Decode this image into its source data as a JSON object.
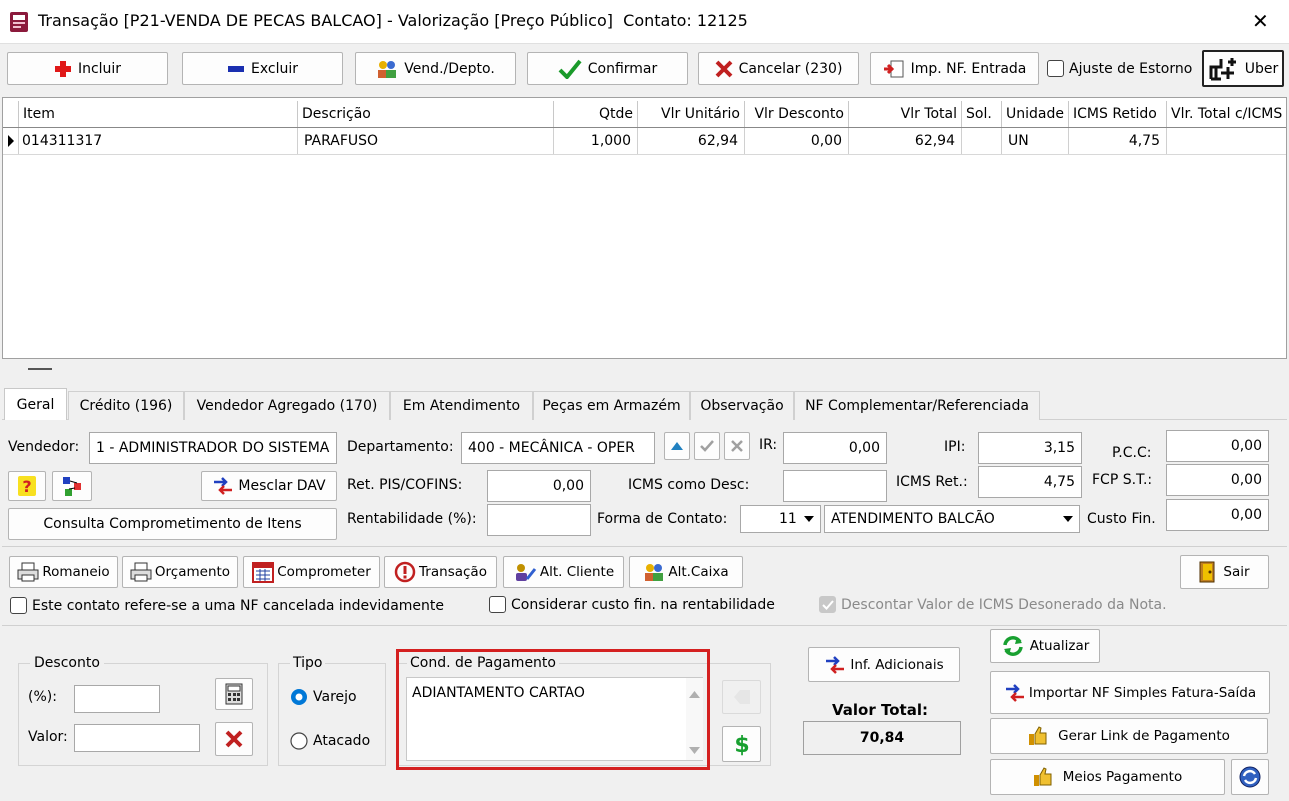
{
  "window": {
    "title": "Transação [P21-VENDA DE PECAS BALCAO] - Valorização [Preço Público]  Contato: 12125",
    "close": "✕"
  },
  "toolbar": {
    "incluir": "Incluir",
    "excluir": "Excluir",
    "vend": "Vend./Depto.",
    "confirmar": "Confirmar",
    "cancelar": "Cancelar (230)",
    "imp_nf": "Imp. NF. Entrada",
    "ajuste": "Ajuste de Estorno",
    "uber": "Uber"
  },
  "grid": {
    "headers": [
      "Item",
      "Descrição",
      "Qtde",
      "Vlr Unitário",
      "Vlr Desconto",
      "Vlr Total",
      "Sol.",
      "Unidade",
      "ICMS Retido",
      "Vlr. Total c/ICMS"
    ],
    "rows": [
      {
        "item": "014311317",
        "descricao": "PARAFUSO",
        "qtde": "1,000",
        "vlr_unit": "62,94",
        "vlr_desc": "0,00",
        "vlr_total": "62,94",
        "sol": "",
        "unidade": "UN",
        "icms_retido": "4,75",
        "total_icms": ""
      }
    ]
  },
  "tabs": [
    "Geral",
    "Crédito (196)",
    "Vendedor Agregado (170)",
    "Em Atendimento",
    "Peças em Armazém",
    "Observação",
    "NF Complementar/Referenciada"
  ],
  "geral": {
    "vendedor_label": "Vendedor:",
    "vendedor_value": "1 - ADMINISTRADOR DO SISTEMA",
    "departamento_label": "Departamento:",
    "departamento_value": "400 - MECÂNICA - OPER",
    "ir_label": "IR:",
    "ir_value": "0,00",
    "ipi_label": "IPI:",
    "ipi_value": "3,15",
    "pcc_label": "P.C.C:",
    "pcc_value": "0,00",
    "mesclar": "Mesclar DAV",
    "ret_label": "Ret. PIS/COFINS:",
    "ret_value": "0,00",
    "icms_desc_label": "ICMS como Desc:",
    "icms_desc_value": "",
    "icms_ret_label": "ICMS Ret.:",
    "icms_ret_value": "4,75",
    "fcp_label": "FCP S.T.:",
    "fcp_value": "0,00",
    "consulta": "Consulta Comprometimento de Itens",
    "rent_label": "Rentabilidade (%):",
    "rent_value": "",
    "forma_label": "Forma de Contato:",
    "forma_code": "11",
    "forma_value": "ATENDIMENTO BALCÃO",
    "custo_label": "Custo Fin.",
    "custo_value": "0,00"
  },
  "actions": {
    "romaneio": "Romaneio",
    "orcamento": "Orçamento",
    "comprometer": "Comprometer",
    "transacao": "Transação",
    "alt_cliente": "Alt. Cliente",
    "alt_caixa": "Alt.Caixa",
    "sair": "Sair"
  },
  "checks": {
    "nf_cancelada": "Este contato refere-se a uma NF cancelada indevidamente",
    "custo_fin": "Considerar custo fin. na rentabilidade",
    "descontar": "Descontar Valor de ICMS Desonerado da Nota."
  },
  "desconto": {
    "title": "Desconto",
    "pct_label": "(%):",
    "pct_value": "",
    "valor_label": "Valor:",
    "valor_value": ""
  },
  "tipo": {
    "title": "Tipo",
    "varejo": "Varejo",
    "atacado": "Atacado",
    "selected": "Varejo"
  },
  "cond": {
    "title": "Cond. de Pagamento",
    "value": "ADIANTAMENTO CARTAO"
  },
  "right": {
    "inf_adicionais": "Inf. Adicionais",
    "atualizar": "Atualizar",
    "importar": "Importar NF Simples Fatura-Saída",
    "valor_total_label": "Valor Total:",
    "valor_total": "70,84",
    "gerar_link": "Gerar Link de Pagamento",
    "meios": "Meios Pagamento"
  },
  "colors": {
    "highlight": "#d42020",
    "accent": "#0078d7"
  }
}
